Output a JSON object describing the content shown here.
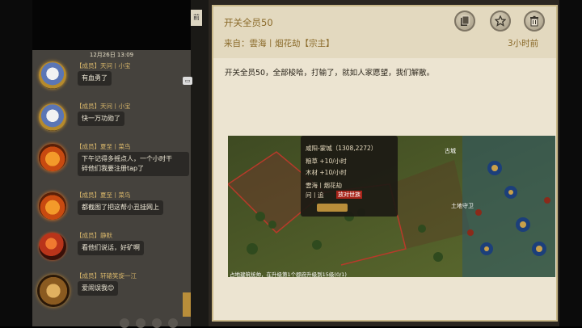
{
  "chat": {
    "tab_label": "前",
    "timestamp": "12月26日 13:09",
    "messages": [
      {
        "name": "【成员】天问丨小宝",
        "text": "有血勇了"
      },
      {
        "name": "【成员】天问丨小宝",
        "text": "快一万功勋了"
      },
      {
        "name": "【成员】夏至丨菜鸟",
        "text_line1": "下午记得多摇点人，一个小时干",
        "text_line2": "碎他们我要注册tap了"
      },
      {
        "name": "【成员】夏至丨菜鸟",
        "text": "都截图了把这帮小丑挂网上"
      },
      {
        "name": "【成员】静默",
        "text": "看他们说话，好矿啊"
      },
      {
        "name": "【成员】轩辕笑旋一江",
        "text": "爱闹误我😊"
      }
    ]
  },
  "mail": {
    "subject": "开关全员50",
    "from": "来自：雲海丨烟花劫【宗主】",
    "time": "3小时前",
    "body": "开关全员50，全部梭哈，打输了，就如人家愿望，我们解散。",
    "buttons": {
      "copy": "copy-icon",
      "favorite": "star-icon",
      "delete": "trash-icon"
    }
  },
  "map_screenshot": {
    "location": "咸阳-蒙城（1308,2272）",
    "grain": "粮草 +10/小时",
    "wood": "木材 +10/小时",
    "owner": "雲海丨烟花劫",
    "alliance": "问丨追",
    "alliance_tag": "放对世族",
    "marker_1": "古城",
    "marker_2": "土地守卫",
    "bottom_text": "占地建筑统帅，在升级第1个郡府升级到15级(0/1)"
  }
}
